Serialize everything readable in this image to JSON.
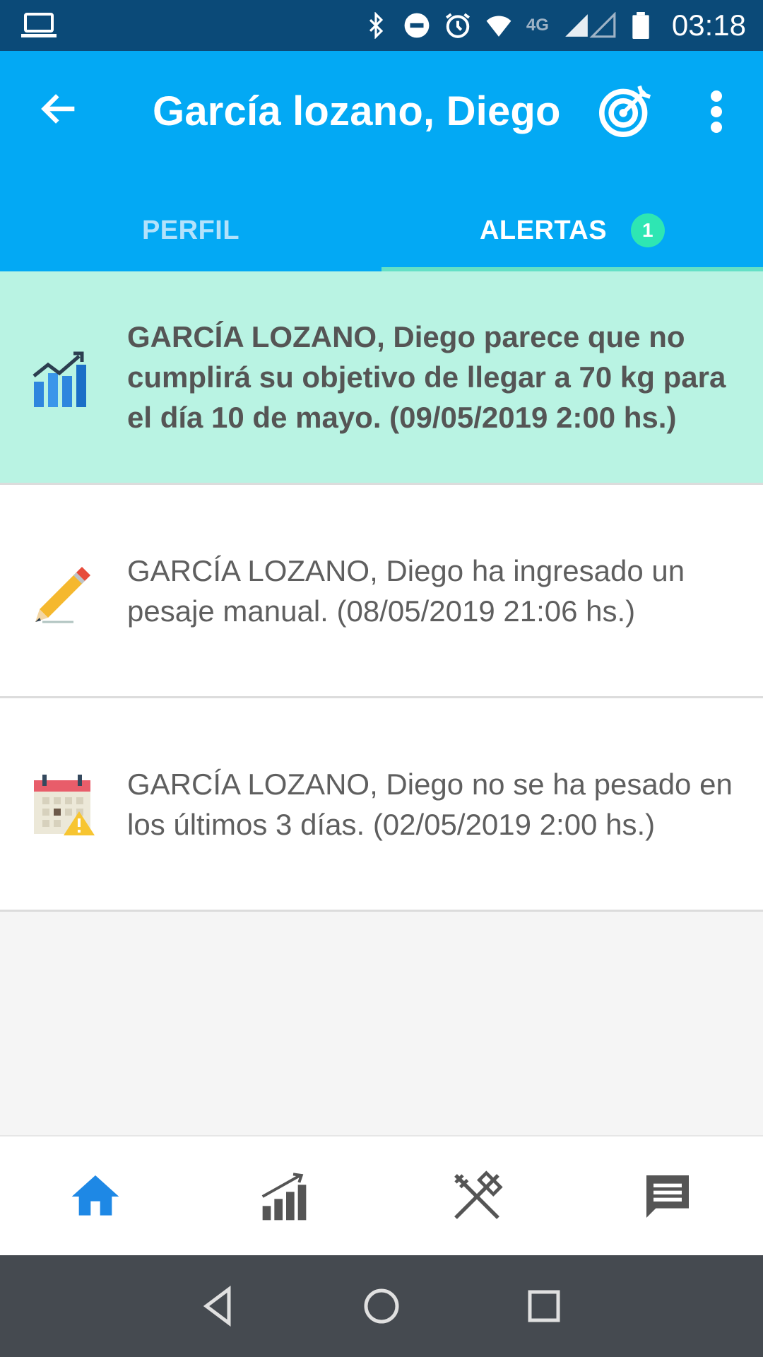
{
  "status_bar": {
    "time": "03:18",
    "network": "4G",
    "icons": [
      "laptop-icon",
      "bluetooth-icon",
      "do-not-disturb-icon",
      "alarm-icon",
      "wifi-icon",
      "signal-icon",
      "battery-icon"
    ]
  },
  "app_bar": {
    "title": "García lozano, Diego",
    "background_color": "#03a9f4",
    "tabs": [
      {
        "label": "PERFIL",
        "active": false
      },
      {
        "label": "ALERTAS",
        "active": true,
        "badge": "1"
      }
    ]
  },
  "alerts": [
    {
      "icon": "chart-growth-icon",
      "text": "GARCÍA LOZANO, Diego parece que no cumplirá su objetivo de llegar a 70 kg para el día 10 de mayo. (09/05/2019 2:00 hs.)",
      "highlighted": true
    },
    {
      "icon": "pencil-icon",
      "text": "GARCÍA LOZANO, Diego ha ingresado un pesaje manual. (08/05/2019 21:06 hs.)",
      "highlighted": false
    },
    {
      "icon": "calendar-warning-icon",
      "text": "GARCÍA LOZANO, Diego no se ha pesado en los últimos 3 días. (02/05/2019 2:00 hs.)",
      "highlighted": false
    }
  ],
  "bottom_nav": {
    "items": [
      {
        "icon": "home-icon",
        "active": true
      },
      {
        "icon": "stats-icon",
        "active": false
      },
      {
        "icon": "cutlery-icon",
        "active": false
      },
      {
        "icon": "chat-icon",
        "active": false
      }
    ],
    "active_color": "#1e88e5"
  }
}
